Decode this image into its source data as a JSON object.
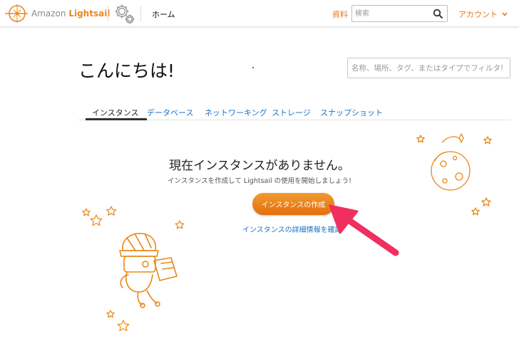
{
  "header": {
    "brand_prefix": "Amazon",
    "brand_name": "Lightsail",
    "home_label": "ホーム",
    "docs_label": "資料",
    "search_placeholder": "検索",
    "account_label": "アカウント",
    "icons": {
      "logo": "lightsail-compass-icon",
      "settings": "gears-icon",
      "search": "search-icon",
      "account": "chevron-down-icon"
    }
  },
  "greeting": "こんにちは!",
  "filter": {
    "placeholder": "名称、場所、タグ、またはタイプでフィルタ!"
  },
  "tabs": [
    {
      "label": "インスタンス",
      "active": true
    },
    {
      "label": "データベース",
      "active": false
    },
    {
      "label": "ネットワーキング",
      "active": false
    },
    {
      "label": "ストレージ",
      "active": false
    },
    {
      "label": "スナップショット",
      "active": false
    }
  ],
  "empty_state": {
    "title": "現在インスタンスがありません。",
    "subtitle": "インスタンスを作成して Lightsail の使用を開始しましょう!",
    "create_button": "インスタンスの作成",
    "learn_link": "インスタンスの詳細情報を確認"
  },
  "colors": {
    "accent": "#e8761b",
    "link": "#1a73c8",
    "annotation_arrow": "#f02f5f"
  }
}
